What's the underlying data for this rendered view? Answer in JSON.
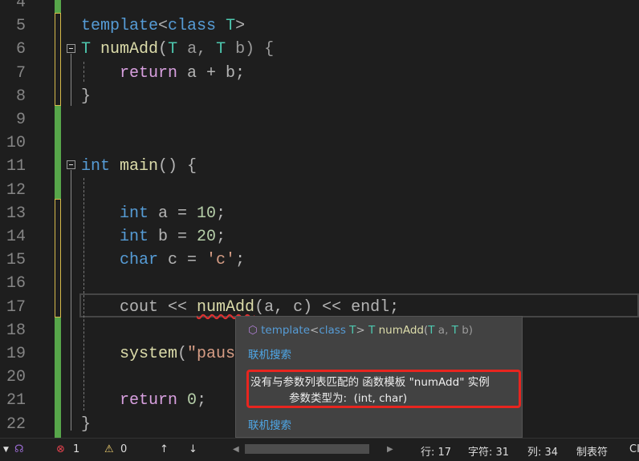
{
  "editor": {
    "lines": [
      {
        "n": "4",
        "t": []
      },
      {
        "n": "5",
        "t": [
          [
            "template",
            "#569cd6"
          ],
          [
            "<",
            "#b4b4b4"
          ],
          [
            "class",
            "#569cd6"
          ],
          [
            " ",
            ""
          ],
          [
            "T",
            "#4ec9b0"
          ],
          [
            ">",
            "#b4b4b4"
          ]
        ]
      },
      {
        "n": "6",
        "t": [
          [
            "T",
            "#4ec9b0"
          ],
          [
            " ",
            ""
          ],
          [
            "numAdd",
            "#dcdcaa"
          ],
          [
            "(",
            "#b4b4b4"
          ],
          [
            "T",
            "#4ec9b0"
          ],
          [
            " a, ",
            "#9a9a9a"
          ],
          [
            "T",
            "#4ec9b0"
          ],
          [
            " b) {",
            "#9a9a9a"
          ]
        ],
        "indent": 0
      },
      {
        "n": "7",
        "t": [
          [
            "    ",
            ""
          ],
          [
            "return",
            "#d8a0df"
          ],
          [
            " a + b;",
            "#b4b4b4"
          ]
        ]
      },
      {
        "n": "8",
        "t": [
          [
            "}",
            "#b4b4b4"
          ]
        ]
      },
      {
        "n": "9",
        "t": []
      },
      {
        "n": "10",
        "t": []
      },
      {
        "n": "11",
        "t": [
          [
            "int",
            "#569cd6"
          ],
          [
            " ",
            ""
          ],
          [
            "main",
            "#dcdcaa"
          ],
          [
            "() {",
            "#b4b4b4"
          ]
        ]
      },
      {
        "n": "12",
        "t": []
      },
      {
        "n": "13",
        "t": [
          [
            "    ",
            ""
          ],
          [
            "int",
            "#569cd6"
          ],
          [
            " a = ",
            "#b4b4b4"
          ],
          [
            "10",
            "#b5cea8"
          ],
          [
            ";",
            "#b4b4b4"
          ]
        ]
      },
      {
        "n": "14",
        "t": [
          [
            "    ",
            ""
          ],
          [
            "int",
            "#569cd6"
          ],
          [
            " b = ",
            "#b4b4b4"
          ],
          [
            "20",
            "#b5cea8"
          ],
          [
            ";",
            "#b4b4b4"
          ]
        ]
      },
      {
        "n": "15",
        "t": [
          [
            "    ",
            ""
          ],
          [
            "char",
            "#569cd6"
          ],
          [
            " c = ",
            "#b4b4b4"
          ],
          [
            "'c'",
            "#d69d85"
          ],
          [
            ";",
            "#b4b4b4"
          ]
        ]
      },
      {
        "n": "16",
        "t": []
      },
      {
        "n": "17",
        "t": [
          [
            "    ",
            ""
          ],
          [
            "cout",
            "#b4b4b4"
          ],
          [
            " << ",
            "#b4b4b4"
          ],
          [
            "numAdd",
            "#dcdcaa",
            "squig"
          ],
          [
            "(a, c) << endl;",
            "#b4b4b4"
          ]
        ]
      },
      {
        "n": "18",
        "t": []
      },
      {
        "n": "19",
        "t": [
          [
            "    ",
            ""
          ],
          [
            "system",
            "#dcdcaa"
          ],
          [
            "(",
            "#b4b4b4"
          ],
          [
            "\"pause\");",
            "#d69d85"
          ]
        ]
      },
      {
        "n": "20",
        "t": []
      },
      {
        "n": "21",
        "t": [
          [
            "    ",
            ""
          ],
          [
            "return",
            "#d8a0df"
          ],
          [
            " ",
            ""
          ],
          [
            "0",
            "#b5cea8"
          ],
          [
            ";",
            "#b4b4b4"
          ]
        ]
      },
      {
        "n": "22",
        "t": [
          [
            "}",
            "#b4b4b4"
          ]
        ]
      }
    ]
  },
  "tooltip": {
    "sig_kw1": "template",
    "sig_lt": "<",
    "sig_kw2": "class",
    "sig_T": "T",
    "sig_gt": ">",
    "sig_T2": "T",
    "sig_fn": "numAdd",
    "sig_p1": "(",
    "sig_T3": "T",
    "sig_a": " a, ",
    "sig_T4": "T",
    "sig_b": " b)",
    "online_search_1": "联机搜索",
    "error_line1": "没有与参数列表匹配的 函数模板 \"numAdd\" 实例",
    "error_line2": "参数类型为:  (int, char)",
    "online_search_2": "联机搜索",
    "error_border_color": "#e8251f"
  },
  "status": {
    "errors": "1",
    "warnings": "0",
    "line": "行: 17",
    "char": "字符: 31",
    "col": "列: 34",
    "tabs": "制表符",
    "enc": "CI"
  }
}
